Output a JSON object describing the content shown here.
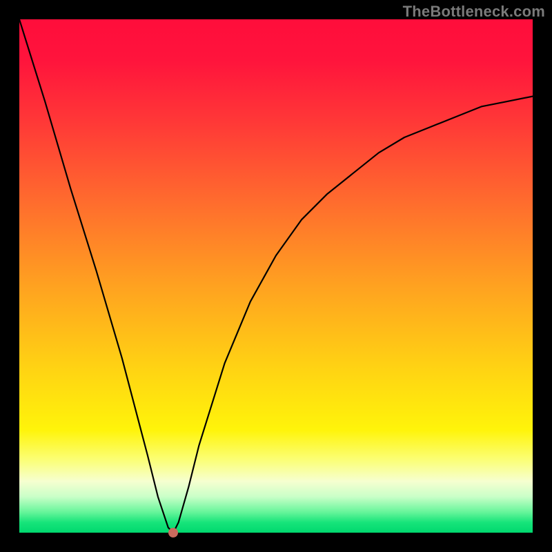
{
  "watermark": "TheBottleneck.com",
  "chart_data": {
    "type": "line",
    "title": "",
    "xlabel": "",
    "ylabel": "",
    "xlim": [
      0,
      100
    ],
    "ylim": [
      0,
      100
    ],
    "grid": false,
    "legend": false,
    "background_gradient": {
      "direction": "vertical",
      "stops": [
        {
          "pos": 0,
          "color": "#ff0d3b"
        },
        {
          "pos": 50,
          "color": "#ffa220"
        },
        {
          "pos": 80,
          "color": "#fff40a"
        },
        {
          "pos": 100,
          "color": "#00d86e"
        }
      ]
    },
    "series": [
      {
        "name": "bottleneck-curve",
        "color": "#000000",
        "x": [
          0,
          5,
          10,
          15,
          20,
          25,
          27,
          29,
          30,
          31,
          33,
          35,
          40,
          45,
          50,
          55,
          60,
          65,
          70,
          75,
          80,
          85,
          90,
          95,
          100
        ],
        "y": [
          100,
          84,
          67,
          51,
          34,
          15,
          7,
          1,
          0,
          2,
          9,
          17,
          33,
          45,
          54,
          61,
          66,
          70,
          74,
          77,
          79,
          81,
          83,
          84,
          85
        ]
      }
    ],
    "annotations": [
      {
        "type": "point",
        "name": "min-marker",
        "x": 30,
        "y": 0,
        "color": "#c96a5d"
      }
    ],
    "minimum": {
      "x": 30,
      "y": 0
    }
  },
  "layout": {
    "image_size": 800,
    "inner_margin": 28,
    "plot_size": 744
  }
}
